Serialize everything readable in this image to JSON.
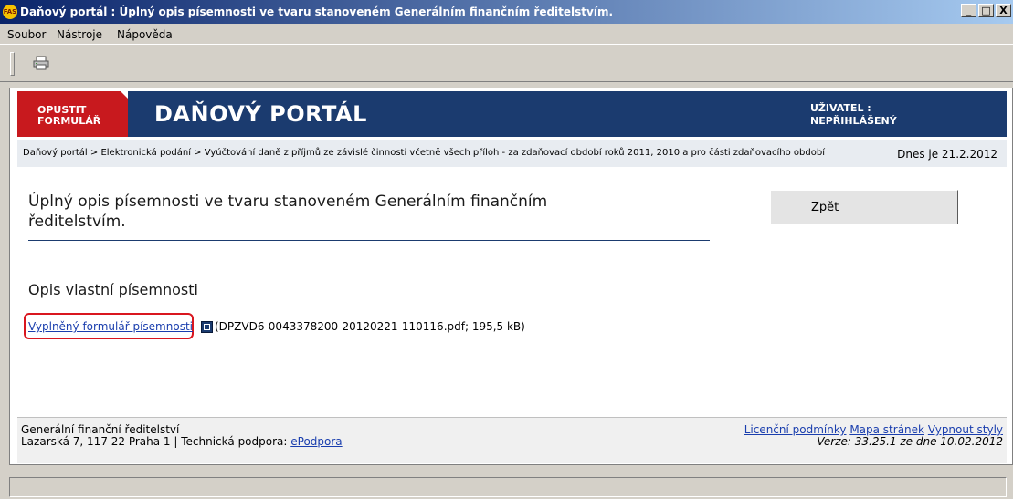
{
  "window": {
    "app_icon_text": "FAS",
    "title": "Daňový portál : Úplný opis písemnosti ve tvaru stanoveném Generálním finančním ředitelstvím.",
    "buttons": [
      "_",
      "□",
      "X"
    ]
  },
  "menu": {
    "items": [
      "Soubor",
      "Nástroje",
      "Nápověda"
    ]
  },
  "toolbar": {
    "print_icon": "print-icon"
  },
  "header": {
    "exit_label": "OPUSTIT FORMULÁŘ",
    "portal_title": "DAŇOVÝ PORTÁL",
    "user_label": "UŽIVATEL :",
    "user_value": "NEPŘIHLÁŠENÝ"
  },
  "breadcrumb": {
    "path": "Daňový portál > Elektronická podání > Vyúčtování daně z příjmů ze závislé činnosti včetně všech příloh - za zdaňovací období roků 2011, 2010 a pro části zdaňovacího období",
    "date": "Dnes je 21.2.2012"
  },
  "main": {
    "title": "Úplný opis písemnosti ve tvaru stanoveném Generálním finančním ředitelstvím.",
    "back_button": "Zpět",
    "section_title": "Opis vlastní písemnosti",
    "form_link": "Vyplněný formulář písemnosti",
    "file_info": "(DPZVD6-0043378200-20120221-110116.pdf; 195,5 kB)"
  },
  "footer": {
    "org": "Generální finanční ředitelství",
    "address": "Lazarská 7, 117 22 Praha 1 | Technická podpora: ",
    "support_link": "ePodpora",
    "links": [
      "Licenční podmínky",
      "Mapa stránek",
      "Vypnout styly"
    ],
    "version": "Verze: 33.25.1 ze dne 10.02.2012"
  },
  "colors": {
    "header_bg": "#1b3b6f",
    "exit_bg": "#c8191e",
    "highlight": "#d9161f",
    "link": "#1a3eae"
  }
}
